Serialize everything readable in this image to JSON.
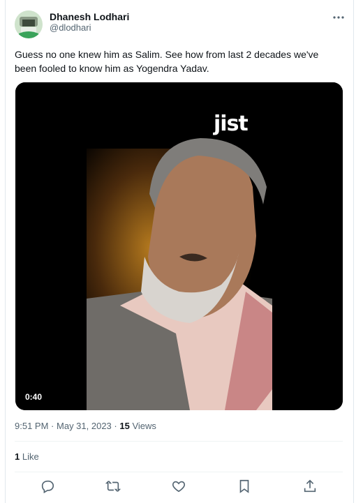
{
  "tweet": {
    "author_name": "Dhanesh Lodhari",
    "author_handle": "@dlodhari",
    "more_icon": "more-horizontal-icon",
    "text": "Guess no one knew him as Salim. See how from last 2 decades we've been fooled to know him as Yogendra Yadav.",
    "video": {
      "overlay_logo": "jist",
      "duration": "0:40"
    },
    "meta": {
      "time": "9:51 PM",
      "separator": "·",
      "date": "May 31, 2023",
      "views_count": "15",
      "views_label": "Views"
    },
    "likes": {
      "count": "1",
      "label": "Like"
    },
    "actions": [
      {
        "name": "reply-icon"
      },
      {
        "name": "retweet-icon"
      },
      {
        "name": "like-icon"
      },
      {
        "name": "bookmark-icon"
      },
      {
        "name": "share-icon"
      }
    ]
  }
}
